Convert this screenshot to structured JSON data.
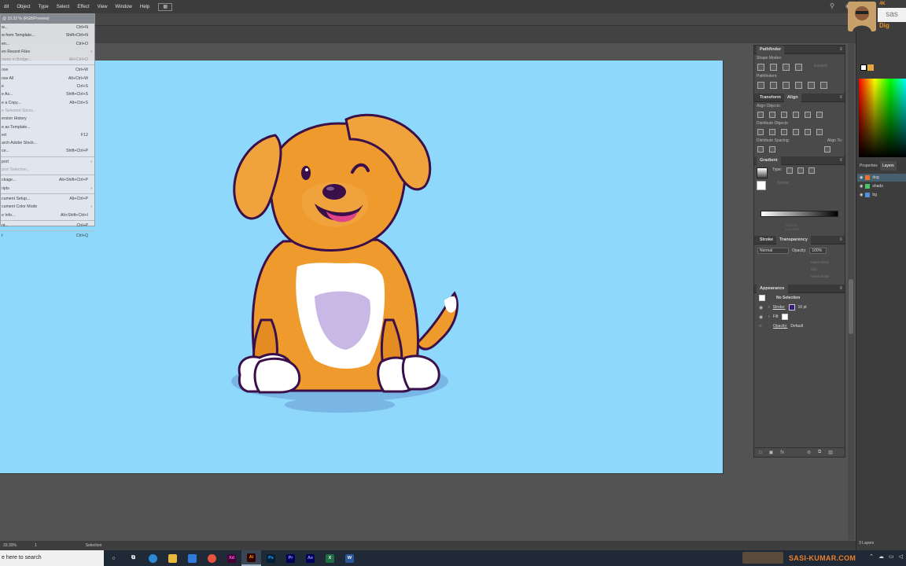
{
  "menubar": {
    "items": [
      "dit",
      "Object",
      "Type",
      "Select",
      "Effect",
      "View",
      "Window",
      "Help"
    ],
    "workspace_icon": "grid-icon",
    "right_icons": [
      "search-icon",
      "settings-icon"
    ]
  },
  "file_menu": {
    "header": "@ 33.33 % (RGB/Preview)",
    "rows": [
      {
        "label": "w...",
        "shortcut": "Ctrl+N",
        "disabled": false
      },
      {
        "label": "w from Template...",
        "shortcut": "Shift+Ctrl+N",
        "disabled": false
      },
      {
        "label": "en...",
        "shortcut": "Ctrl+O",
        "disabled": false
      },
      {
        "label": "en Recent Files",
        "shortcut": "",
        "disabled": false,
        "submenu": true
      },
      {
        "label": "owse in Bridge...",
        "shortcut": "Alt+Ctrl+O",
        "disabled": true
      },
      {
        "label": "ose",
        "shortcut": "Ctrl+W",
        "disabled": false,
        "sep_before": true
      },
      {
        "label": "ose All",
        "shortcut": "Alt+Ctrl+W",
        "disabled": false
      },
      {
        "label": "e",
        "shortcut": "Ctrl+S",
        "disabled": false
      },
      {
        "label": "e As...",
        "shortcut": "Shift+Ctrl+S",
        "disabled": false
      },
      {
        "label": "e a Copy...",
        "shortcut": "Alt+Ctrl+S",
        "disabled": false
      },
      {
        "label": "e Selected Slices...",
        "shortcut": "",
        "disabled": true
      },
      {
        "label": "ersion History",
        "shortcut": "",
        "disabled": false
      },
      {
        "label": "e as Template...",
        "shortcut": "",
        "disabled": false
      },
      {
        "label": "ert",
        "shortcut": "F12",
        "disabled": false
      },
      {
        "label": "arch Adobe Stock...",
        "shortcut": "",
        "disabled": false
      },
      {
        "label": "ce...",
        "shortcut": "Shift+Ctrl+P",
        "disabled": false
      },
      {
        "label": "port",
        "shortcut": "",
        "disabled": false,
        "submenu": true,
        "sep_before": true
      },
      {
        "label": "port Selection...",
        "shortcut": "",
        "disabled": true
      },
      {
        "label": "ckage...",
        "shortcut": "Alt+Shift+Ctrl+P",
        "disabled": false,
        "sep_before": true
      },
      {
        "label": "ripts",
        "shortcut": "",
        "disabled": false,
        "submenu": true
      },
      {
        "label": "cument Setup...",
        "shortcut": "Alt+Ctrl+P",
        "disabled": false,
        "sep_before": true
      },
      {
        "label": "cument Color Mode",
        "shortcut": "",
        "disabled": false,
        "submenu": true
      },
      {
        "label": "e Info...",
        "shortcut": "Alt+Shift+Ctrl+I",
        "disabled": false
      },
      {
        "label": "nt...",
        "shortcut": "Ctrl+P",
        "disabled": false,
        "sep_before": true
      },
      {
        "label": "t",
        "shortcut": "Ctrl+Q",
        "disabled": false,
        "sep_before": true
      }
    ]
  },
  "pathfinder": {
    "title": "Pathfinder",
    "shape_modes": "Shape Modes:",
    "expand": "Expand",
    "pathfinders": "Pathfinders:"
  },
  "align": {
    "tabs": [
      "Transform",
      "Align"
    ],
    "align_objects": "Align Objects:",
    "distribute_objects": "Distribute Objects:",
    "distribute_spacing": "Distribute Spacing:",
    "align_to": "Align To:"
  },
  "gradient": {
    "title": "Gradient",
    "type_label": "Type:",
    "stroke_label": "Stroke:",
    "opacity_label": "Opacity:",
    "location_label": "Location:"
  },
  "transparency": {
    "tabs": [
      "Stroke",
      "Transparency"
    ],
    "blend_mode": "Normal",
    "opacity_label": "Opacity:",
    "opacity_value": "100%",
    "make_mask": "Make Mask",
    "clip": "Clip",
    "invert_mask": "Invert Mask"
  },
  "appearance": {
    "title": "Appearance",
    "selection": "No Selection",
    "stroke_label": "Stroke:",
    "stroke_value": "16 pt",
    "fill_label": "Fill:",
    "opacity_label": "Opacity:",
    "opacity_value": "Default",
    "bottom_icons": [
      "square-icon",
      "layers-icon",
      "fx-icon",
      "clear-icon",
      "duplicate-icon",
      "trash-icon"
    ]
  },
  "layers": {
    "tabs": [
      "Properties",
      "Layers"
    ],
    "rows": [
      {
        "name": "dog",
        "color": "#e5732b"
      },
      {
        "name": "shado",
        "color": "#4cc36a"
      },
      {
        "name": "bg",
        "color": "#4c8fe3"
      }
    ],
    "count": "3 Layers"
  },
  "brand": {
    "box_text": "sas",
    "sub": "Dig",
    "badge": "4K"
  },
  "statusbar": {
    "zoom": "33.33%",
    "page": "1",
    "tool": "Selection"
  },
  "taskbar": {
    "search_placeholder": "e here to search",
    "apps": [
      "Xd",
      "Ai",
      "Ps",
      "Pr",
      "Ae",
      "X",
      "W"
    ],
    "watermark": "SASI-KUMAR.COM"
  },
  "colors": {
    "artboard": "#8ed8fb",
    "dog_body": "#ee9a2d",
    "dog_outline": "#3a0f4a",
    "accent_orange": "#f07f2a"
  }
}
